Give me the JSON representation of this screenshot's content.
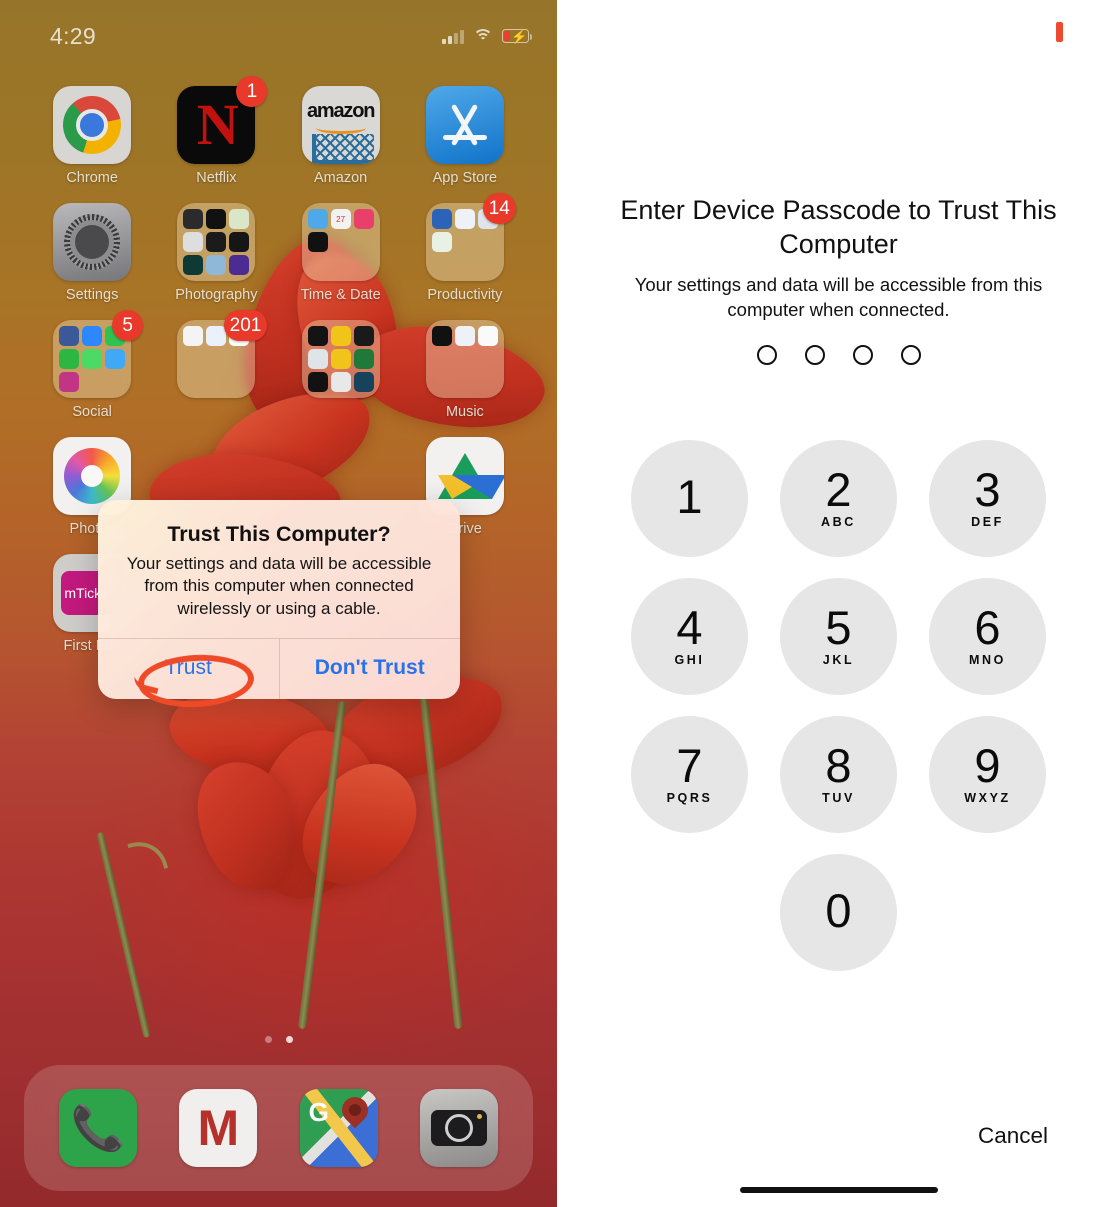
{
  "left_phone": {
    "status_bar": {
      "time": "4:29",
      "signal_icon": "cellular-signal-icon",
      "wifi_icon": "wifi-icon",
      "battery_icon": "battery-charging-icon"
    },
    "rows": [
      [
        {
          "label": "Chrome",
          "type": "app",
          "icon": "chrome-icon",
          "badge": null
        },
        {
          "label": "Netflix",
          "type": "app",
          "icon": "netflix-icon",
          "badge": "1"
        },
        {
          "label": "Amazon",
          "type": "app",
          "icon": "amazon-icon",
          "badge": null
        },
        {
          "label": "App Store",
          "type": "app",
          "icon": "app-store-icon",
          "badge": null
        }
      ],
      [
        {
          "label": "Settings",
          "type": "app",
          "icon": "settings-gear-icon",
          "badge": null
        },
        {
          "label": "Photography",
          "type": "folder",
          "icon": "folder-photography",
          "badge": null
        },
        {
          "label": "Time & Date",
          "type": "folder",
          "icon": "folder-time-date",
          "badge": null
        },
        {
          "label": "Productivity",
          "type": "folder",
          "icon": "folder-productivity",
          "badge": "14"
        }
      ],
      [
        {
          "label": "Social",
          "type": "folder",
          "icon": "folder-social",
          "badge": "5"
        },
        {
          "label": "",
          "type": "folder",
          "icon": "folder-google",
          "badge": "201"
        },
        {
          "label": "",
          "type": "folder",
          "icon": "folder-utilities",
          "badge": null
        },
        {
          "label": "Music",
          "type": "folder",
          "icon": "folder-music",
          "badge": null
        }
      ],
      [
        {
          "label": "Photos",
          "type": "app",
          "icon": "photos-icon",
          "badge": null
        },
        {
          "label": "",
          "type": "empty",
          "icon": "",
          "badge": null
        },
        {
          "label": "",
          "type": "empty",
          "icon": "",
          "badge": null
        },
        {
          "label": "Drive",
          "type": "app",
          "icon": "google-drive-icon",
          "badge": null
        }
      ],
      [
        {
          "label": "First Bus",
          "type": "app",
          "icon": "mtickets-first-bus-icon",
          "badge": null
        },
        {
          "label": "",
          "type": "empty",
          "icon": "",
          "badge": null
        },
        {
          "label": "",
          "type": "empty",
          "icon": "",
          "badge": null
        },
        {
          "label": "",
          "type": "empty",
          "icon": "",
          "badge": null
        }
      ]
    ],
    "page_dots": {
      "count": 2,
      "active_index": 1
    },
    "dock": [
      {
        "label": "Phone",
        "icon": "phone-icon"
      },
      {
        "label": "Gmail",
        "icon": "gmail-icon"
      },
      {
        "label": "Google Maps",
        "icon": "google-maps-icon"
      },
      {
        "label": "Camera",
        "icon": "camera-icon"
      }
    ],
    "alert": {
      "title": "Trust This Computer?",
      "message": "Your settings and data will be accessible from this computer when connected wirelessly or using a cable.",
      "buttons": [
        {
          "label": "Trust",
          "emphasis": "normal",
          "highlighted": true
        },
        {
          "label": "Don't Trust",
          "emphasis": "bold",
          "highlighted": false
        }
      ],
      "annotation_color": "#ef4a28"
    }
  },
  "right_passcode": {
    "title": "Enter Device Passcode to Trust This Computer",
    "subtitle": "Your settings and data will be accessible from this computer when connected.",
    "passcode_dots": {
      "total": 4,
      "filled": 0
    },
    "keys": [
      {
        "num": "1",
        "sub": ""
      },
      {
        "num": "2",
        "sub": "ABC"
      },
      {
        "num": "3",
        "sub": "DEF"
      },
      {
        "num": "4",
        "sub": "GHI"
      },
      {
        "num": "5",
        "sub": "JKL"
      },
      {
        "num": "6",
        "sub": "MNO"
      },
      {
        "num": "7",
        "sub": "PQRS"
      },
      {
        "num": "8",
        "sub": "TUV"
      },
      {
        "num": "9",
        "sub": "WXYZ"
      },
      {
        "num": "0",
        "sub": ""
      }
    ],
    "cancel_label": "Cancel",
    "marker_color": "#ee4a30"
  }
}
